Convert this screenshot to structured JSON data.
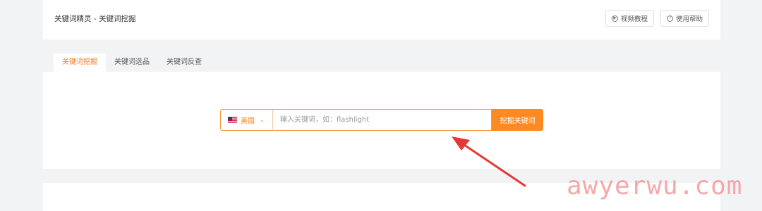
{
  "header": {
    "title": "关键词精灵 - 关键词挖掘",
    "video_label": "视频教程",
    "help_label": "使用帮助"
  },
  "tabs": [
    {
      "label": "关键词挖掘",
      "active": true
    },
    {
      "label": "关键词选品",
      "active": false
    },
    {
      "label": "关键词反查",
      "active": false
    }
  ],
  "search": {
    "country": "美国",
    "placeholder": "输入关键词，如：flashlight",
    "value": "",
    "button_label": "挖掘关键词"
  },
  "watermark": "awyerwu.com",
  "colors": {
    "accent": "#ff8a22",
    "arrow": "#e53935",
    "watermark": "#f49a9a"
  },
  "icons": [
    "play-circle-icon",
    "help-circle-icon",
    "us-flag-icon",
    "chevron-down-icon"
  ]
}
